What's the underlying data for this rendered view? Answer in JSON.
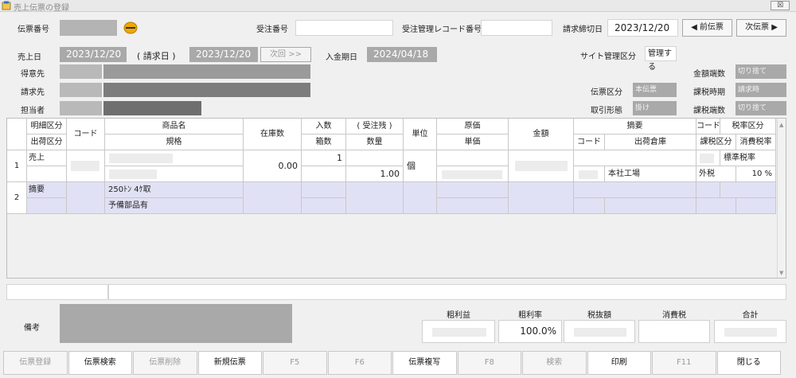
{
  "window": {
    "title": "売上伝票の登録",
    "close_label": "☒"
  },
  "header": {
    "slip_no_label": "伝票番号",
    "order_no_label": "受注番号",
    "order_mgmt_label": "受注管理レコード番号",
    "closing_date_label": "請求締切日",
    "closing_date": "2023/12/20",
    "prev_label": "◀ 前伝票",
    "next_label": "次伝票 ▶",
    "sales_date_label": "売上日",
    "sales_date": "2023/12/20",
    "bill_date_label": "( 請求日 )",
    "bill_date": "2023/12/20",
    "next_time_label": "次回 >>",
    "payment_due_label": "入金期日",
    "payment_due": "2024/04/18",
    "site_mgmt_label": "サイト管理区分",
    "site_mgmt_value": "管理する",
    "customer_label": "得意先",
    "billing_label": "請求先",
    "staff_label": "担当者",
    "amount_rounding_label": "金額端数",
    "amount_rounding_value": "切り捨て",
    "slip_type_label": "伝票区分",
    "slip_type_value": "本伝票",
    "tax_timing_label": "課税時期",
    "tax_timing_value": "請求時",
    "deal_type_label": "取引形態",
    "deal_type_value": "掛け",
    "tax_rounding_label": "課税端数",
    "tax_rounding_value": "切り捨て"
  },
  "grid": {
    "headers": {
      "detail_type": "明細区分",
      "ship_type": "出荷区分",
      "code": "コード",
      "product_name": "商品名",
      "spec": "規格",
      "stock": "在庫数",
      "in_qty": "入数",
      "box_qty": "箱数",
      "order_remain": "( 受注残 )",
      "qty": "数量",
      "unit": "単位",
      "cost": "原価",
      "unit_price": "単価",
      "amount": "金額",
      "summary": "摘要",
      "code2": "コード",
      "warehouse": "出荷倉庫",
      "code3": "コード",
      "tax_rate_type": "税率区分",
      "tax_type": "課税区分",
      "tax_rate": "消費税率"
    },
    "rows": [
      {
        "no": "1",
        "detail_type": "売上",
        "stock": "0.00",
        "in_qty": "1",
        "qty": "1.00",
        "unit": "個",
        "warehouse": "本社工場",
        "tax_rate_type": "標準税率",
        "tax_type": "外税",
        "tax_rate": "10 %"
      },
      {
        "no": "2",
        "detail_type": "摘要",
        "product_line1": "250ﾄﾝ 4ｹ取",
        "product_line2": "予備部品有"
      }
    ]
  },
  "notes_label": "備考",
  "totals": {
    "gross_profit_label": "粗利益",
    "gross_margin_label": "粗利率",
    "gross_margin": "100.0%",
    "subtotal_label": "税抜額",
    "tax_label": "消費税",
    "total_label": "合計"
  },
  "fkeys": [
    {
      "label": "伝票登録",
      "enabled": false
    },
    {
      "label": "伝票検索",
      "enabled": true
    },
    {
      "label": "伝票削除",
      "enabled": false
    },
    {
      "label": "新規伝票",
      "enabled": true
    },
    {
      "label": "F5",
      "enabled": false
    },
    {
      "label": "F6",
      "enabled": false
    },
    {
      "label": "伝票複写",
      "enabled": true
    },
    {
      "label": "F8",
      "enabled": false
    },
    {
      "label": "検索",
      "enabled": false
    },
    {
      "label": "印刷",
      "enabled": true
    },
    {
      "label": "F11",
      "enabled": false
    },
    {
      "label": "閉じる",
      "enabled": true
    }
  ],
  "colors": {
    "accent": "#f0a800",
    "disabled_field": "#a9a9a9",
    "row_highlight": "#e1e1f5"
  }
}
